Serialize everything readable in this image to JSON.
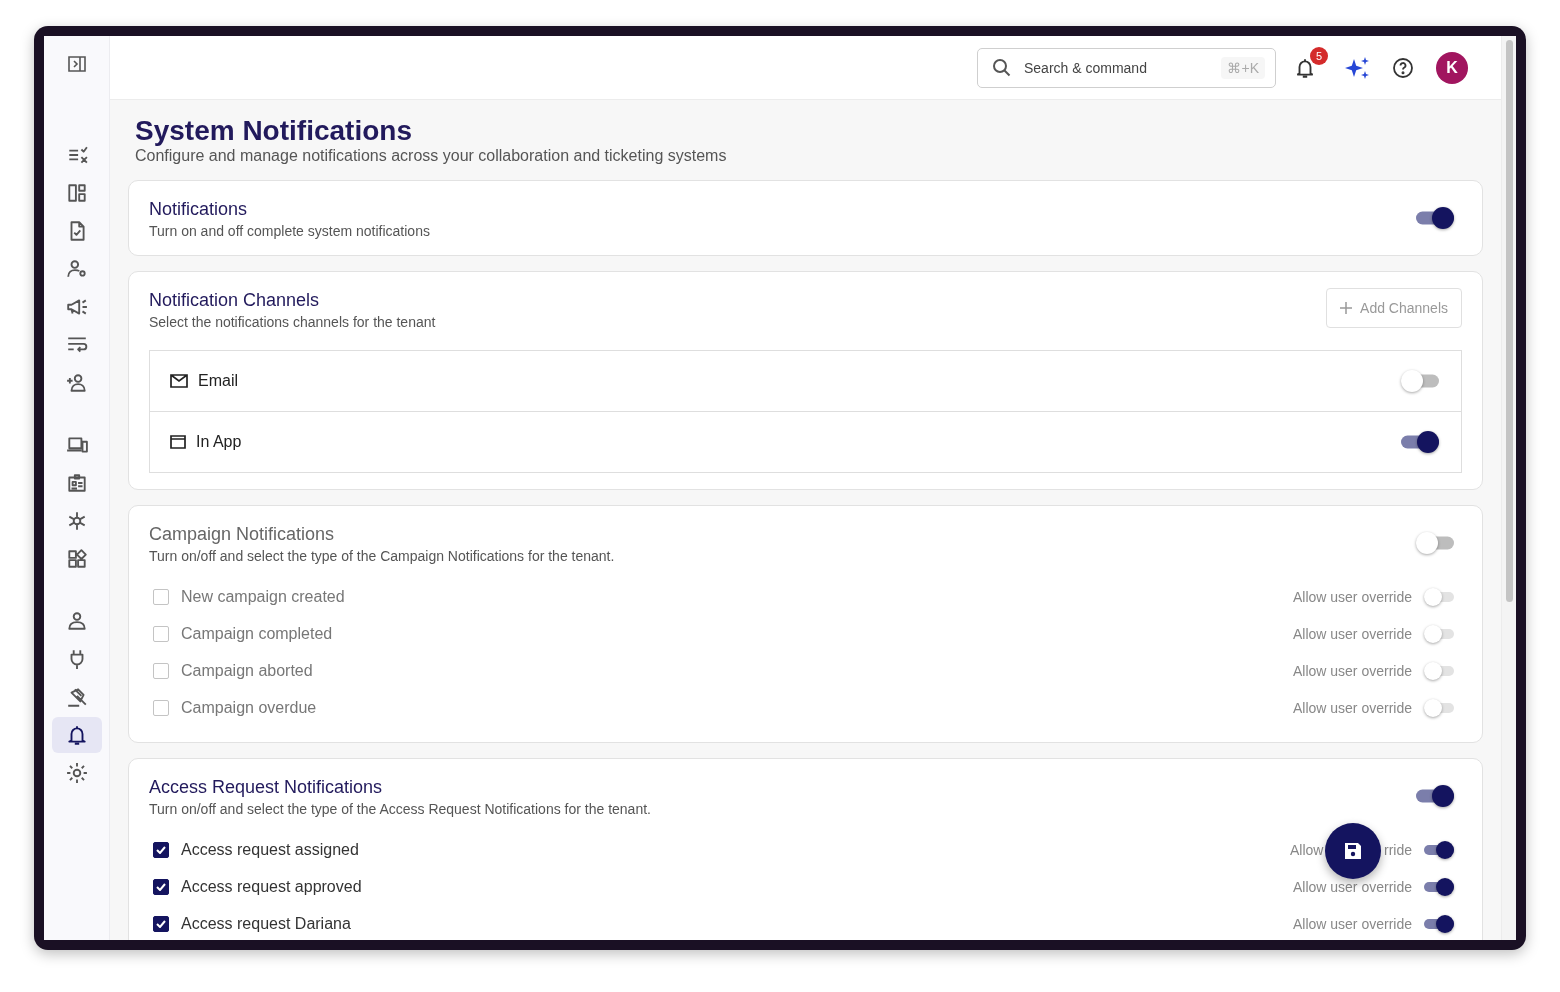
{
  "sidebar": {
    "groups": [
      [
        {
          "selected": false
        },
        {
          "selected": false
        },
        {
          "selected": false
        },
        {
          "selected": false
        },
        {
          "selected": false
        },
        {
          "selected": false
        },
        {
          "selected": false
        }
      ],
      [
        {
          "selected": false
        },
        {
          "selected": false
        },
        {
          "selected": false
        },
        {
          "selected": false
        }
      ],
      [
        {
          "selected": false
        },
        {
          "selected": false
        },
        {
          "selected": false
        },
        {
          "selected": true
        },
        {
          "selected": false
        }
      ]
    ]
  },
  "topbar": {
    "search": {
      "placeholder": "Search & command",
      "shortcut": "⌘+K"
    },
    "notification_count": "5",
    "avatar": "K"
  },
  "page": {
    "title": "System Notifications",
    "subtitle": "Configure and manage notifications across your collaboration and ticketing systems"
  },
  "sections": [
    {
      "kind": "toggle",
      "title": "Notifications",
      "description": "Turn on and off complete system notifications",
      "on": true
    },
    {
      "kind": "channels",
      "title": "Notification Channels",
      "description": "Select the notifications channels for the tenant",
      "add_button": "Add Channels",
      "channels": [
        {
          "label": "Email",
          "on": false
        },
        {
          "label": "In App",
          "on": true
        }
      ]
    },
    {
      "kind": "checklist",
      "title": "Campaign Notifications",
      "description": "Turn on/off and select the type of the Campaign Notifications for the tenant.",
      "on": false,
      "items": [
        {
          "label": "New campaign created",
          "checked": false,
          "override_label": "Allow user override",
          "override_on": false
        },
        {
          "label": "Campaign completed",
          "checked": false,
          "override_label": "Allow user override",
          "override_on": false
        },
        {
          "label": "Campaign aborted",
          "checked": false,
          "override_label": "Allow user override",
          "override_on": false
        },
        {
          "label": "Campaign overdue",
          "checked": false,
          "override_label": "Allow user override",
          "override_on": false
        }
      ]
    },
    {
      "kind": "checklist",
      "title": "Access Request Notifications",
      "description": "Turn on/off and select the type of the Access Request Notifications for the tenant.",
      "on": true,
      "items": [
        {
          "label": "Access request assigned",
          "checked": true,
          "override_label": "Allow",
          "override_label_tail": "rride",
          "override_on": true
        },
        {
          "label": "Access request approved",
          "checked": true,
          "override_label": "Allow user override",
          "override_on": true
        },
        {
          "label": "Access request Dariana",
          "checked": true,
          "override_label": "Allow user override",
          "override_on": true
        }
      ]
    }
  ]
}
